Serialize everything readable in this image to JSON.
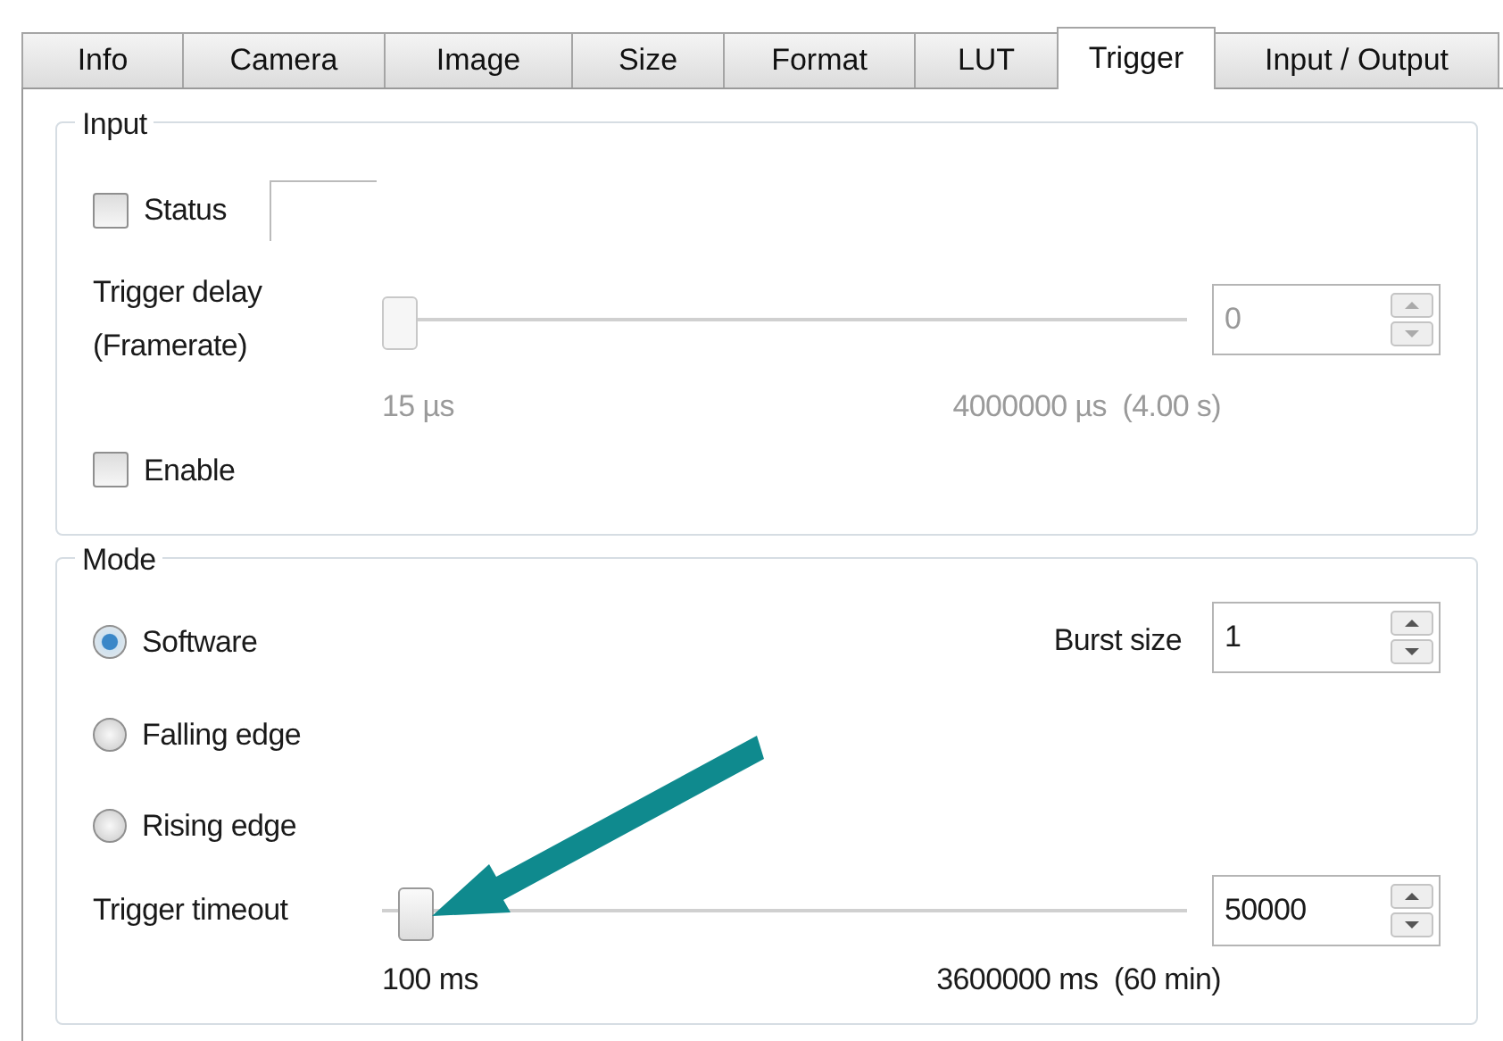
{
  "tabs": [
    {
      "label": "Info",
      "selected": false
    },
    {
      "label": "Camera",
      "selected": false
    },
    {
      "label": "Image",
      "selected": false
    },
    {
      "label": "Size",
      "selected": false
    },
    {
      "label": "Format",
      "selected": false
    },
    {
      "label": "LUT",
      "selected": false
    },
    {
      "label": "Trigger",
      "selected": true
    },
    {
      "label": "Input / Output",
      "selected": false
    }
  ],
  "input": {
    "title": "Input",
    "status": {
      "label": "Status",
      "checked": false
    },
    "trigger_delay": {
      "label": "Trigger delay (Framerate)",
      "disabled": true,
      "level": 0,
      "value": "0",
      "min_label": "15 µs",
      "max_label": "4000000 µs  (4.00 s)"
    },
    "enable": {
      "label": "Enable",
      "checked": false
    }
  },
  "mode": {
    "title": "Mode",
    "options": [
      {
        "label": "Software",
        "selected": true
      },
      {
        "label": "Falling edge",
        "selected": false
      },
      {
        "label": "Rising edge",
        "selected": false
      }
    ],
    "burst_size": {
      "label": "Burst size",
      "value": "1"
    },
    "trigger_timeout": {
      "label": "Trigger timeout",
      "disabled": false,
      "level": 0.02,
      "value": "50000",
      "min_label": "100 ms",
      "max_label": "3600000 ms  (60 min)"
    }
  }
}
